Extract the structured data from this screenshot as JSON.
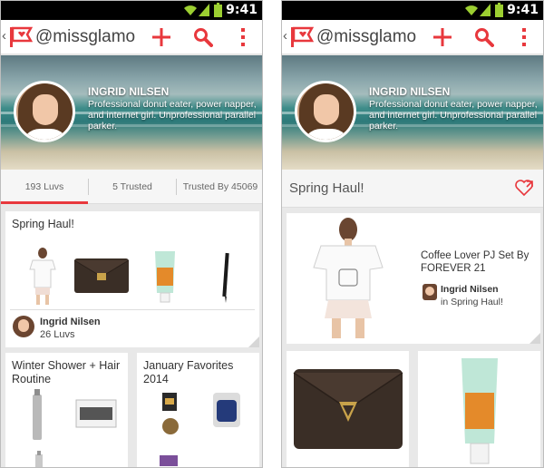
{
  "status_bar": {
    "time": "9:41"
  },
  "app_bar": {
    "handle": "@missglamorazzi"
  },
  "profile": {
    "name": "INGRID NILSEN",
    "bio": "Professional donut eater, power napper, and internet girl. Unprofessional parallel parker."
  },
  "tabs": [
    {
      "label": "193 Luvs",
      "active": true
    },
    {
      "label": "5 Trusted",
      "active": false
    },
    {
      "label": "Trusted By 45069",
      "active": false
    }
  ],
  "collections": [
    {
      "title": "Spring Haul!",
      "owner": "Ingrid Nilsen",
      "luvs": "26 Luvs"
    },
    {
      "title": "Winter Shower + Hair Routine"
    },
    {
      "title": "January Favorites 2014"
    }
  ],
  "detail": {
    "title": "Spring Haul!",
    "featured": {
      "title": "Coffee Lover PJ Set By FOREVER 21",
      "owner": "Ingrid Nilsen",
      "in": "in Spring Haul!"
    }
  },
  "colors": {
    "accent": "#e8383d",
    "statusbar": "#000000",
    "battery_icon": "#9ccf31"
  },
  "icons": [
    "wifi-icon",
    "signal-icon",
    "battery-icon",
    "back-icon",
    "logo-icon",
    "add-icon",
    "search-icon",
    "more-icon",
    "heart-icon"
  ]
}
